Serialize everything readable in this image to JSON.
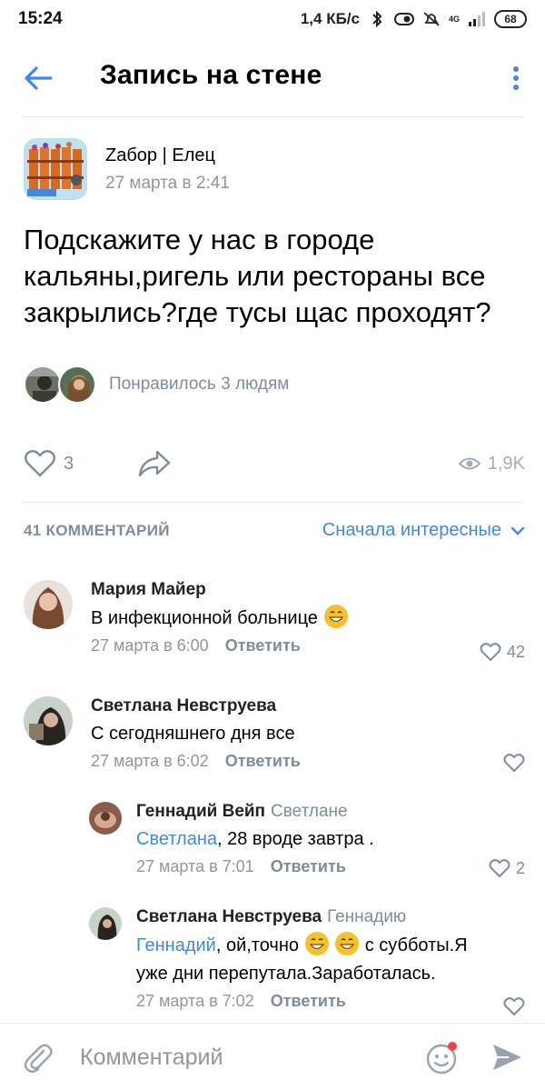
{
  "status_bar": {
    "time": "15:24",
    "network_speed": "1,4 КБ/с",
    "signal": "4G",
    "battery": "68"
  },
  "header": {
    "title": "Запись на стене"
  },
  "post": {
    "author": "Zабор | Елец",
    "date": "27 марта в 2:41",
    "text": "Подскажите у нас в городе кальяны,ригель или рестораны все закрылись?где тусы щас проходят?",
    "likes_text": "Понравилось 3 людям",
    "like_count": "3",
    "views": "1,9K"
  },
  "comments_header": {
    "count": "41 КОММЕНТАРИЙ",
    "sort": "Сначала интересные"
  },
  "comments": [
    {
      "name": "Мария Майер",
      "reply_to": "",
      "mention": "",
      "text": "В инфекционной больнице",
      "date": "27 марта в 6:00",
      "reply": "Ответить",
      "likes": "42"
    },
    {
      "name": "Светлана Невструева",
      "reply_to": "",
      "mention": "",
      "text": "С сегодняшнего дня все",
      "date": "27 марта в 6:02",
      "reply": "Ответить",
      "likes": ""
    },
    {
      "name": "Геннадий Вейп",
      "reply_to": "Светлане",
      "mention": "Светлана",
      "text": ", 28 вроде завтра .",
      "date": "27 марта в 7:01",
      "reply": "Ответить",
      "likes": "2"
    },
    {
      "name": "Светлана Невструева",
      "reply_to": "Геннадию",
      "mention": "Геннадий",
      "text_a": ", ой,точно",
      "text_b": "с субботы.Я",
      "text_c": "уже дни перепутала.Заработалась.",
      "date": "27 марта в 7:02",
      "reply": "Ответить",
      "likes": ""
    }
  ],
  "composer": {
    "placeholder": "Комментарий"
  },
  "colors": {
    "accent": "#3f8ae0",
    "secondary_text": "#818c99",
    "divider": "#e7e8ec"
  },
  "icons": [
    "back-arrow-icon",
    "more-vertical-icon",
    "heart-icon",
    "share-icon",
    "eye-icon",
    "chevron-down-icon",
    "paperclip-icon",
    "smile-icon",
    "send-icon"
  ]
}
